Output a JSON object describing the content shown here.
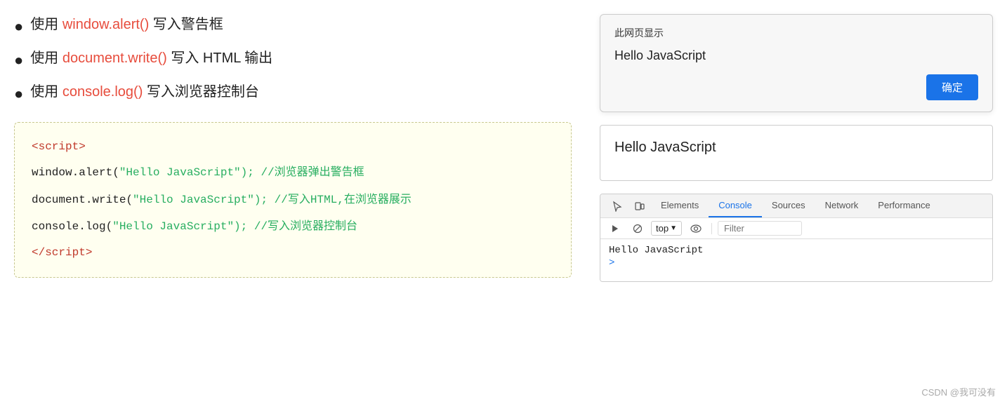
{
  "bullets": [
    {
      "text_before": "使用 ",
      "code": "window.alert()",
      "text_after": " 写入警告框"
    },
    {
      "text_before": "使用 ",
      "code": "document.write()",
      "text_after": " 写入 HTML 输出"
    },
    {
      "text_before": "使用 ",
      "code": "console.log()",
      "text_after": " 写入浏览器控制台"
    }
  ],
  "code": {
    "open_tag": "<script>",
    "line1_plain": "window.alert(",
    "line1_string": "\"Hello JavaScript\"",
    "line1_rest": "); //浏览器弹出警告框",
    "line2_plain": "document.write(",
    "line2_string": "\"Hello JavaScript\"",
    "line2_rest": "); //写入HTML,在浏览器展示",
    "line3_plain": "console.log(",
    "line3_string": "\"Hello JavaScript\"",
    "line3_rest": "); //写入浏览器控制台",
    "close_tag": "</script>"
  },
  "alert_dialog": {
    "title": "此网页显示",
    "message": "Hello JavaScript",
    "confirm_label": "确定"
  },
  "doc_write": {
    "output": "Hello JavaScript"
  },
  "console": {
    "tabs": [
      "Elements",
      "Console",
      "Sources",
      "Network",
      "Performance"
    ],
    "active_tab": "Console",
    "top_label": "top",
    "filter_placeholder": "Filter",
    "output_line": "Hello JavaScript",
    "prompt": ">"
  },
  "watermark": "CSDN @我可没有"
}
